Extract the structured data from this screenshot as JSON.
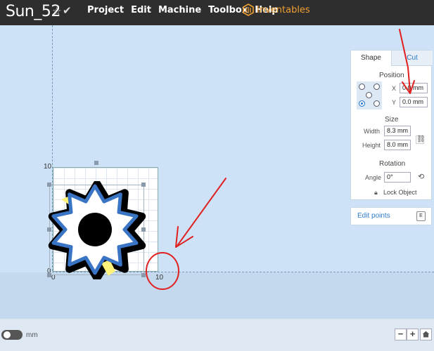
{
  "header": {
    "title": "Sun_52",
    "star_icon": "star-outline-icon",
    "check_icon": "checkmark-icon",
    "menu": [
      "Project",
      "Edit",
      "Machine",
      "Toolbox",
      "Help"
    ],
    "brand": "Inventables",
    "brand_color": "#f0a030"
  },
  "workspace": {
    "y_max_label": "10",
    "y_zero_label": "0",
    "x_zero_label": "0",
    "x_max_label": "10"
  },
  "panel": {
    "tabs": [
      "Shape",
      "Cut"
    ],
    "position_title": "Position",
    "x_label": "X",
    "x_value": "0.0 mm",
    "y_label": "Y",
    "y_value": "0.0 mm",
    "size_title": "Size",
    "width_label": "Width",
    "width_value": "8.3 mm",
    "height_label": "Height",
    "height_value": "8.0 mm",
    "rotation_title": "Rotation",
    "angle_label": "Angle",
    "angle_value": "0°",
    "lock_label": "Lock Object",
    "edit_points_label": "Edit points",
    "edit_points_key": "E"
  },
  "footer": {
    "unit": "mm",
    "zoom_out": "−",
    "zoom_in": "+"
  },
  "colors": {
    "accent": "#2a7ac8",
    "annotation": "#e02020",
    "gear_outline": "#3a74c4",
    "highlight": "#fff27a"
  }
}
